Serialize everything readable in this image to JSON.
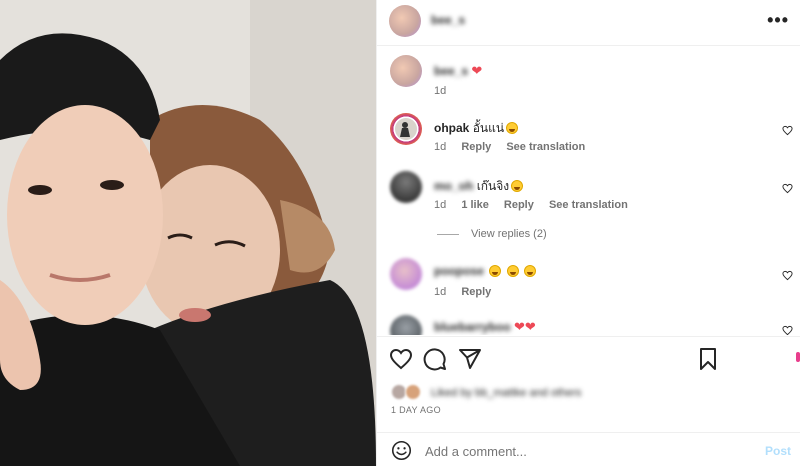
{
  "header": {
    "username": "bee_s",
    "more_icon": "more-horizontal-icon"
  },
  "caption": {
    "username": "bee_s",
    "heart": "❤",
    "time": "1d"
  },
  "comments": [
    {
      "username": "ohpak",
      "text": "อั้นแน่",
      "emoji": "star-struck",
      "time": "1d",
      "reply": "Reply",
      "translate": "See translation",
      "blurred": false
    },
    {
      "username": "mo_oh",
      "text": "เก๊นจิง",
      "emoji": "grinning",
      "time": "1d",
      "likes": "1 like",
      "reply": "Reply",
      "translate": "See translation",
      "blurred": true
    },
    {
      "username": "poopose",
      "time": "1d",
      "reply": "Reply",
      "blurred": true
    },
    {
      "username": "bluebarryboo",
      "blurred": true
    }
  ],
  "view_replies": "View replies (2)",
  "actions": {
    "like": "heart-icon",
    "comment": "comment-icon",
    "share": "send-icon",
    "save": "bookmark-icon"
  },
  "liked_by": "Liked by bb_mattke and others",
  "time_ago": "1 DAY AGO",
  "add_comment": {
    "placeholder": "Add a comment...",
    "post_label": "Post"
  },
  "colors": {
    "accent_red": "#ed4956",
    "post_blue": "#b2dffc",
    "text": "#262626",
    "muted": "#737373"
  }
}
